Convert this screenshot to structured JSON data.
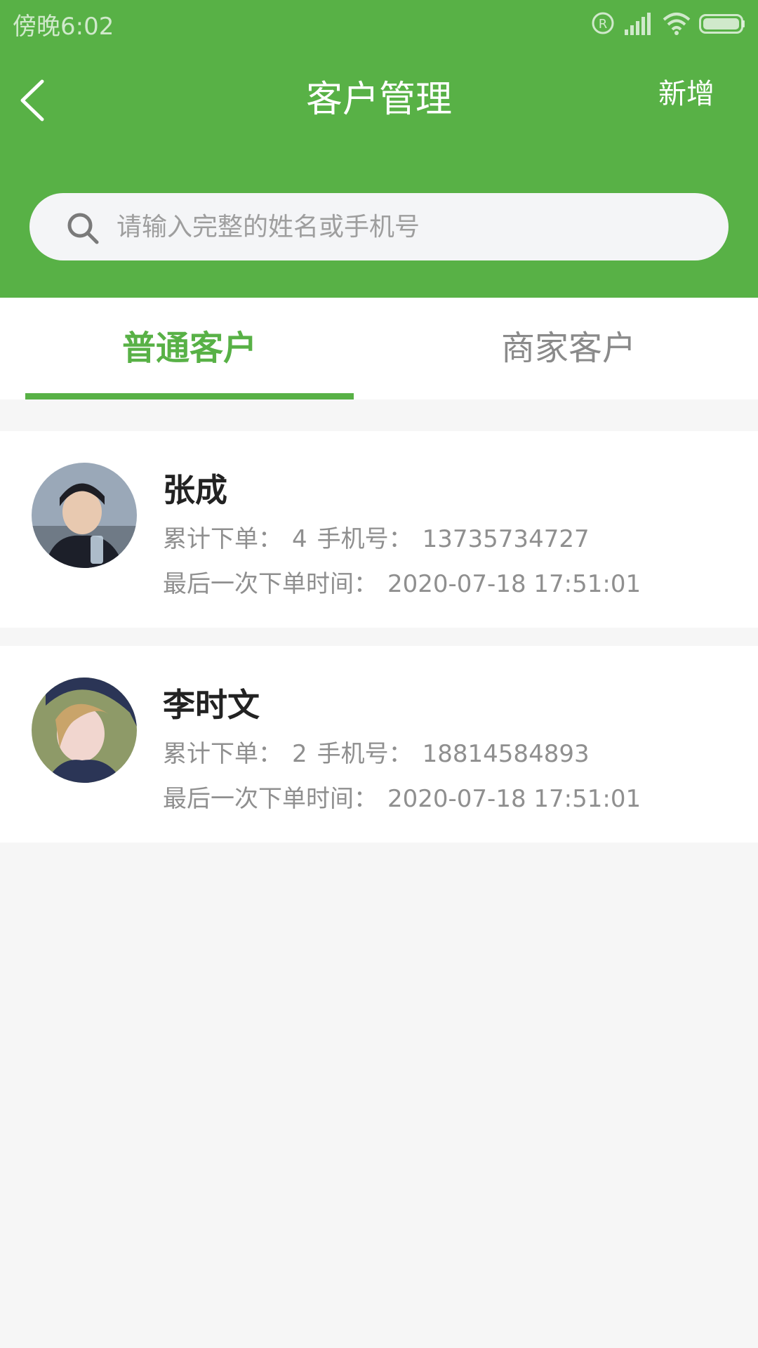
{
  "status_bar": {
    "time": "傍晚6:02",
    "icons": [
      "registered-icon",
      "signal-icon",
      "wifi-icon",
      "battery-icon"
    ]
  },
  "nav": {
    "title": "客户管理",
    "add_label": "新增"
  },
  "search": {
    "placeholder": "请输入完整的姓名或手机号"
  },
  "tabs": [
    {
      "label": "普通客户",
      "active": true
    },
    {
      "label": "商家客户",
      "active": false
    }
  ],
  "customers": [
    {
      "name": "张成",
      "orders_label": "累计下单：",
      "orders": "4",
      "phone_label": "手机号：",
      "phone": "13735734727",
      "last_order_label": "最后一次下单时间：",
      "last_order_time": "2020-07-18 17:51:01"
    },
    {
      "name": "李时文",
      "orders_label": "累计下单：",
      "orders": "2",
      "phone_label": "手机号：",
      "phone": "18814584893",
      "last_order_label": "最后一次下单时间：",
      "last_order_time": "2020-07-18 17:51:01"
    }
  ],
  "colors": {
    "brand_green": "#58b146",
    "background": "#f6f6f6",
    "text_primary": "#222222",
    "text_secondary": "#8f8f8f"
  }
}
